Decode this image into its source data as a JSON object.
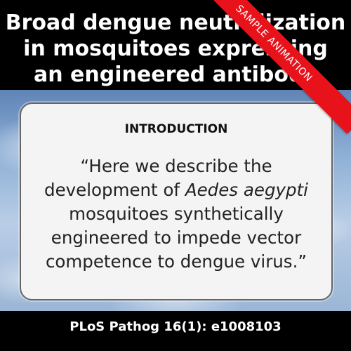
{
  "title": {
    "line1": "Broad dengue neutralization",
    "line2": "in mosquitoes expressing",
    "line3": "an engineered antibody"
  },
  "card": {
    "heading": "INTRODUCTION",
    "quote_line1": "“Here we describe the",
    "quote_line2_pre": "development of ",
    "quote_line2_em": "Aedes aegypti",
    "quote_line3": "mosquitoes synthetically",
    "quote_line4": "engineered to impede vector",
    "quote_line5": "competence to dengue virus.”"
  },
  "footer": {
    "citation": "PLoS Pathog 16(1): e1008103"
  },
  "ribbon": {
    "label": "SAMPLE ANIMATION",
    "color": "#e8121b"
  }
}
